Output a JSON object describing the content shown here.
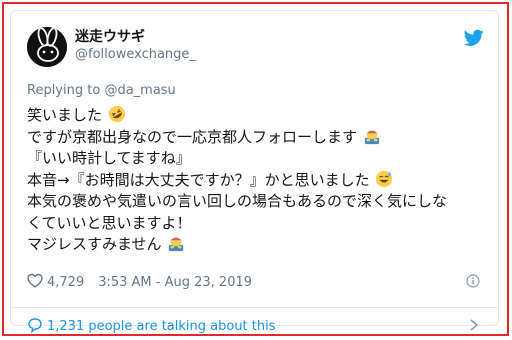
{
  "user": {
    "display_name": "迷走ウサギ",
    "handle": "@followexchange_",
    "avatar_icon": "rabbit-avatar-icon"
  },
  "platform_icon": "twitter-bird-icon",
  "reply": {
    "prefix": "Replying to",
    "mention": "@da_masu"
  },
  "tweet": {
    "lines": [
      "笑いました",
      "ですが京都出身なので一応京都人フォローします",
      "『いい時計してますね』",
      "本音→『お時間は大丈夫ですか？』かと思いました",
      "本気の褒めや気遣いの言い回しの場合もあるので深く気にしな",
      "くていいと思いますよ！",
      "マジレスすみません"
    ],
    "emojis": [
      "rolling-on-floor-laughing-emoji",
      "man-bowing-emoji",
      "grinning-sweat-emoji",
      "man-bowing-emoji"
    ]
  },
  "meta": {
    "likes": "4,729",
    "timestamp": "3:53 AM - Aug 23, 2019"
  },
  "conversation": {
    "label": "1,231 people are talking about this"
  },
  "colors": {
    "accent": "#1b95e0",
    "border": "#e0282f",
    "muted": "#657786"
  }
}
